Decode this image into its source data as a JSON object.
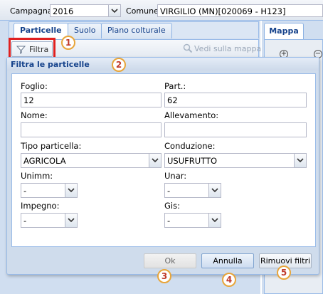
{
  "topbar": {
    "campagna_label": "Campagna:",
    "campagna_value": "2016",
    "comune_label": "Comune:",
    "comune_value": "VIRGILIO (MN)[020069 - H123]"
  },
  "tabs": [
    "Particelle",
    "Suolo",
    "Piano colturale"
  ],
  "toolbar": {
    "filtra_label": "Filtra",
    "vedi_label": "Vedi sulla mappa"
  },
  "map": {
    "tab_label": "Mappa",
    "zoom_in": "+",
    "zoom_out": "−"
  },
  "dialog": {
    "title": "Filtra le particelle",
    "fields": {
      "foglio_label": "Foglio:",
      "foglio_value": "12",
      "part_label": "Part.:",
      "part_value": "62",
      "nome_label": "Nome:",
      "nome_value": "",
      "allevamento_label": "Allevamento:",
      "allevamento_value": "",
      "tipo_label": "Tipo particella:",
      "tipo_value": "AGRICOLA",
      "conduzione_label": "Conduzione:",
      "conduzione_value": "USUFRUTTO",
      "unimm_label": "Unimm:",
      "unimm_value": "-",
      "unar_label": "Unar:",
      "unar_value": "-",
      "impegno_label": "Impegno:",
      "impegno_value": "-",
      "gis_label": "Gis:",
      "gis_value": "-"
    },
    "buttons": {
      "ok": "Ok",
      "annulla": "Annulla",
      "rimuovi": "Rimuovi filtri"
    }
  },
  "badges": [
    "1",
    "2",
    "3",
    "4",
    "5"
  ],
  "colors": {
    "highlight": "#e02020",
    "badge_border": "#e8a53a",
    "badge_text": "#c0392b",
    "panel_title": "#15428b"
  }
}
